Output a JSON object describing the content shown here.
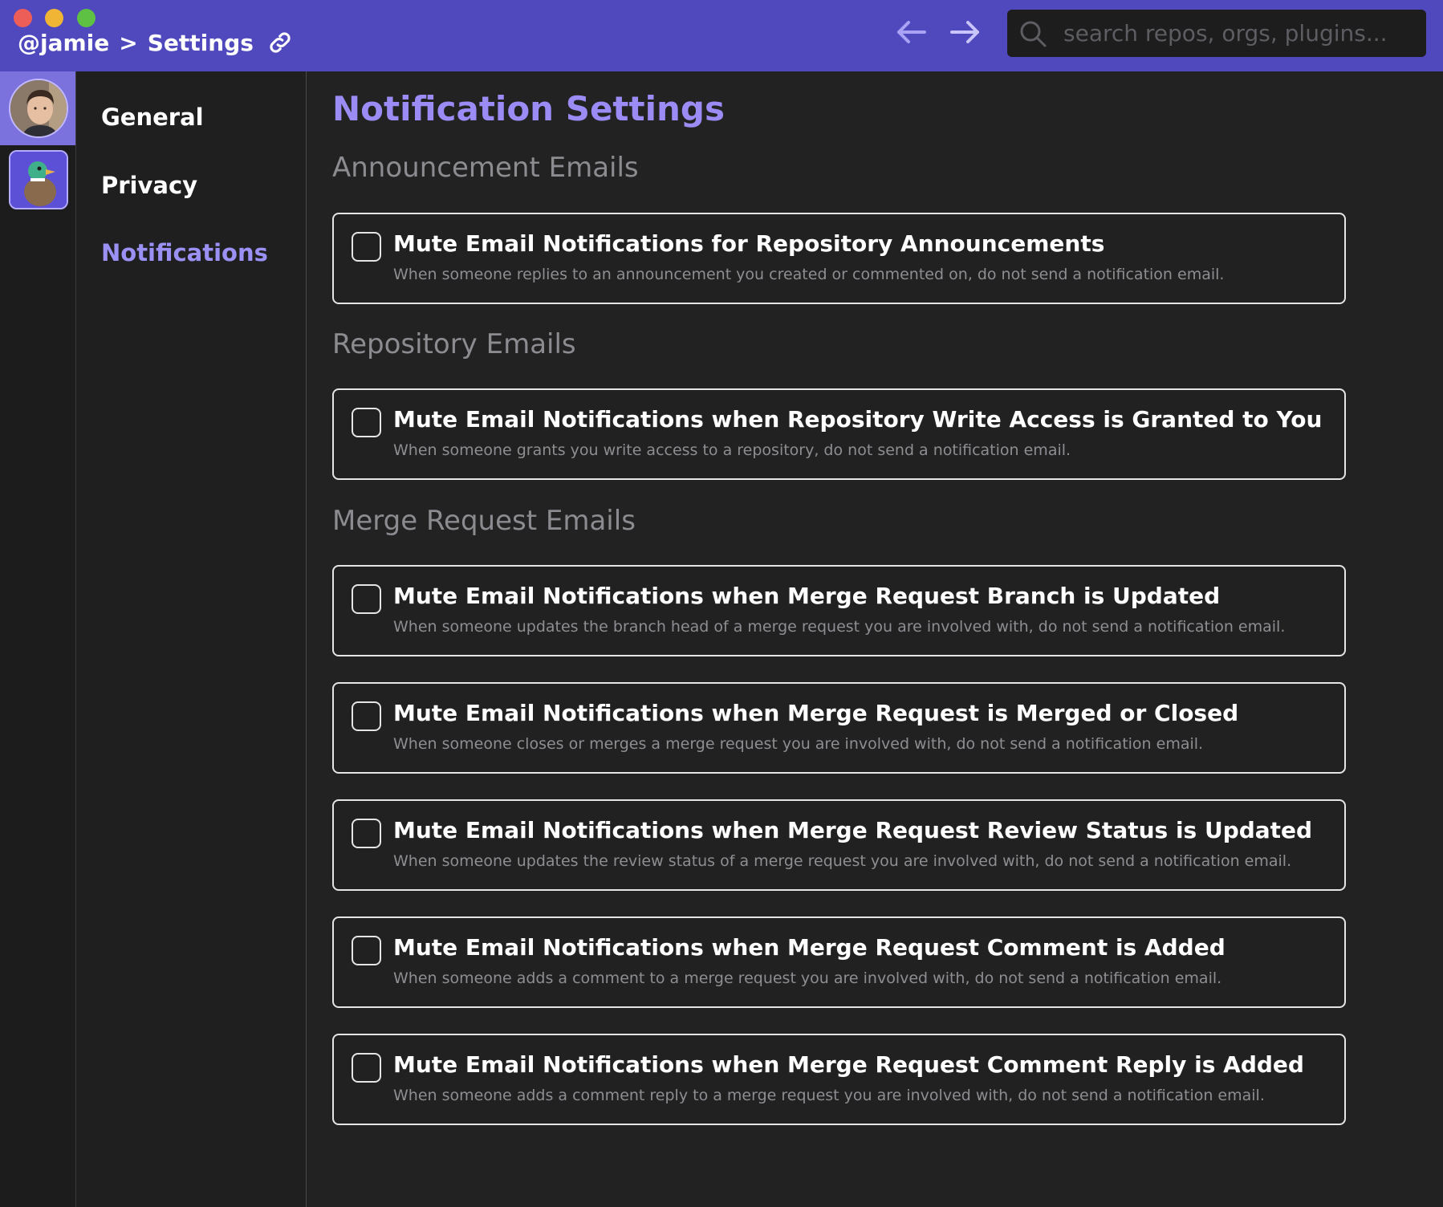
{
  "window": {
    "breadcrumb_user": "@jamie",
    "breadcrumb_sep": ">",
    "breadcrumb_page": "Settings"
  },
  "search": {
    "placeholder": "search repos, orgs, plugins..."
  },
  "sidenav": {
    "items": [
      {
        "label": "General"
      },
      {
        "label": "Privacy"
      },
      {
        "label": "Notifications"
      }
    ],
    "active": "Notifications"
  },
  "main": {
    "title": "Notification Settings",
    "sections": [
      {
        "title": "Announcement Emails",
        "options": [
          {
            "title": "Mute Email Notifications for Repository Announcements",
            "description": "When someone replies to an announcement you created or commented on, do not send a notification email.",
            "checked": false
          }
        ]
      },
      {
        "title": "Repository Emails",
        "options": [
          {
            "title": "Mute Email Notifications when Repository Write Access is Granted to You",
            "description": "When someone grants you write access to a repository, do not send a notification email.",
            "checked": false
          }
        ]
      },
      {
        "title": "Merge Request Emails",
        "options": [
          {
            "title": "Mute Email Notifications when Merge Request Branch is Updated",
            "description": "When someone updates the branch head of a merge request you are involved with, do not send a notification email.",
            "checked": false
          },
          {
            "title": "Mute Email Notifications when Merge Request is Merged or Closed",
            "description": "When someone closes or merges a merge request you are involved with, do not send a notification email.",
            "checked": false
          },
          {
            "title": "Mute Email Notifications when Merge Request Review Status is Updated",
            "description": "When someone updates the review status of a merge request you are involved with, do not send a notification email.",
            "checked": false
          },
          {
            "title": "Mute Email Notifications when Merge Request Comment is Added",
            "description": "When someone adds a comment to a merge request you are involved with, do not send a notification email.",
            "checked": false
          },
          {
            "title": "Mute Email Notifications when Merge Request Comment Reply is Added",
            "description": "When someone adds a comment reply to a merge request you are involved with, do not send a notification email.",
            "checked": false
          }
        ]
      }
    ]
  },
  "colors": {
    "titlebar": "#4f49bd",
    "accent": "#9b8cf5",
    "background": "#222223"
  },
  "icons": [
    "link-icon",
    "back-arrow-icon",
    "forward-arrow-icon",
    "search-icon"
  ]
}
